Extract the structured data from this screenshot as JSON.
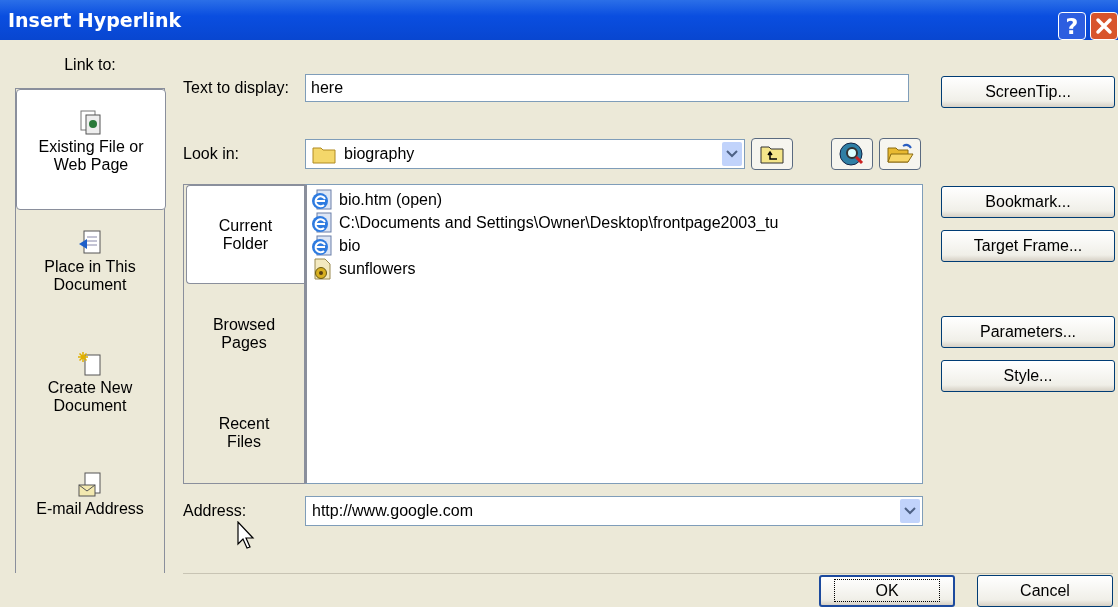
{
  "window": {
    "title": "Insert Hyperlink",
    "help_button": "?"
  },
  "link_to": {
    "label": "Link to:",
    "items": [
      {
        "label": "Existing File or Web Page",
        "kind": "file",
        "selected": true
      },
      {
        "label": "Place in This Document",
        "kind": "place",
        "selected": false
      },
      {
        "label": "Create New Document",
        "kind": "new",
        "selected": false
      },
      {
        "label": "E-mail Address",
        "kind": "email",
        "selected": false
      }
    ]
  },
  "text_to_display": {
    "label": "Text to display:",
    "value": "here"
  },
  "screentip_button": "ScreenTip...",
  "look_in": {
    "label": "Look in:",
    "value": "biography"
  },
  "sub_tabs": [
    {
      "label": "Current Folder",
      "selected": true
    },
    {
      "label": "Browsed Pages",
      "selected": false
    },
    {
      "label": "Recent Files",
      "selected": false
    }
  ],
  "files": [
    {
      "name": "bio.htm (open)",
      "kind": "web"
    },
    {
      "name": "C:\\Documents and Settings\\Owner\\Desktop\\frontpage2003_tu",
      "kind": "web"
    },
    {
      "name": "bio",
      "kind": "web"
    },
    {
      "name": "sunflowers",
      "kind": "image"
    }
  ],
  "side_buttons": [
    "Bookmark...",
    "Target Frame...",
    "Parameters...",
    "Style..."
  ],
  "address": {
    "label": "Address:",
    "value": "http://www.google.com"
  },
  "buttons": [
    {
      "label": "OK",
      "default": true
    },
    {
      "label": "Cancel",
      "default": false
    }
  ]
}
